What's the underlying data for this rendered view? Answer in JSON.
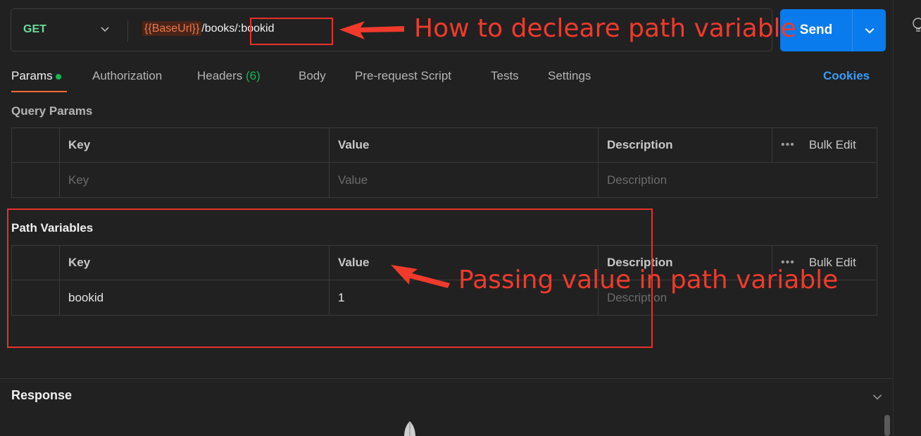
{
  "request": {
    "method": "GET",
    "url_var": "{{BaseUrl}}",
    "url_path": "/books",
    "url_param": "/:bookid",
    "send_label": "Send"
  },
  "tabs": [
    {
      "label": "Params",
      "active": true
    },
    {
      "label": "Authorization"
    },
    {
      "label": "Headers",
      "count": "(6)"
    },
    {
      "label": "Body"
    },
    {
      "label": "Pre-request Script"
    },
    {
      "label": "Tests"
    },
    {
      "label": "Settings"
    }
  ],
  "cookies_label": "Cookies",
  "query_params": {
    "title": "Query Params",
    "headers": {
      "key": "Key",
      "value": "Value",
      "description": "Description",
      "bulk_edit": "Bulk Edit"
    },
    "placeholders": {
      "key": "Key",
      "value": "Value",
      "description": "Description"
    }
  },
  "path_variables": {
    "title": "Path Variables",
    "headers": {
      "key": "Key",
      "value": "Value",
      "description": "Description",
      "bulk_edit": "Bulk Edit"
    },
    "rows": [
      {
        "key": "bookid",
        "value": "1",
        "description_placeholder": "Description"
      }
    ]
  },
  "annotations": {
    "declare": "How to decleare path variable",
    "passing": "Passing value in path variable"
  },
  "response": {
    "title": "Response"
  },
  "colors": {
    "method_get": "#6bdd9a",
    "send_button": "#097bed",
    "active_tab_underline": "#ff6c37",
    "annotation_red": "#f03a2c",
    "cookies_link": "#3b9bf5"
  }
}
